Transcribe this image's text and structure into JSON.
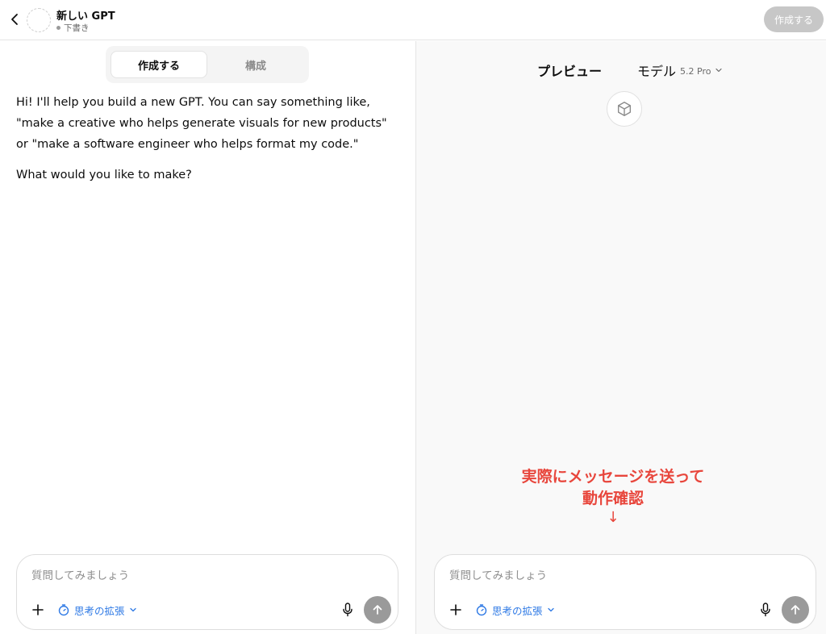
{
  "header": {
    "title": "新しい GPT",
    "status": "下書き",
    "create_button": "作成する"
  },
  "left": {
    "tabs": [
      {
        "label": "作成する",
        "active": true
      },
      {
        "label": "構成",
        "active": false
      }
    ],
    "message": {
      "paragraph1": "Hi! I'll help you build a new GPT. You can say something like, \"make a creative who helps generate visuals for new products\" or \"make a software engineer who helps format my code.\"",
      "paragraph2": "What would you like to make?"
    },
    "composer": {
      "placeholder": "質問してみましょう",
      "think_label": "思考の拡張"
    }
  },
  "right": {
    "preview_label": "プレビュー",
    "model_label": "モデル",
    "model_version": "5.2 Pro",
    "annotation_line1": "実際にメッセージを送って",
    "annotation_line2": "動作確認",
    "annotation_arrow": "↓",
    "composer": {
      "placeholder": "質問してみましょう",
      "think_label": "思考の拡張"
    }
  },
  "colors": {
    "accent_blue": "#2f7ae5",
    "annotation_red": "#e8463c",
    "disabled_button": "#c7c7c7",
    "send_button": "#9a9a9a"
  },
  "icons": {
    "back": "chevron-left-icon",
    "preview": "cube-icon",
    "plus": "plus-icon",
    "think": "timer-icon",
    "mic": "microphone-icon",
    "send": "arrow-up-icon",
    "dropdown": "chevron-down-icon"
  }
}
